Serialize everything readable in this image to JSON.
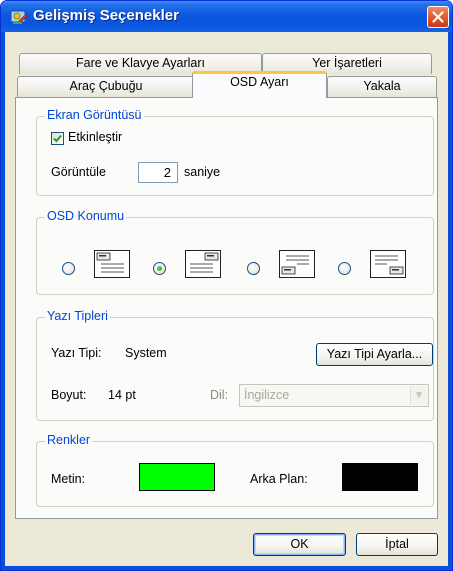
{
  "window": {
    "title": "Gelişmiş Seçenekler",
    "app_icon": "options-app-icon",
    "close_icon": "close-icon"
  },
  "tabs": {
    "back_row": [
      {
        "label": "Fare ve Klavye Ayarları"
      },
      {
        "label": "Yer İşaretleri"
      }
    ],
    "front_row": [
      {
        "label": "Araç Çubuğu"
      },
      {
        "label": "OSD Ayarı",
        "active": true
      },
      {
        "label": "Yakala"
      }
    ]
  },
  "ekran": {
    "title": "Ekran Görüntüsü",
    "enable_label": "Etkinleştir",
    "enable_checked": true,
    "display_label": "Görüntüle",
    "seconds_value": "2",
    "seconds_unit": "saniye"
  },
  "osd_position": {
    "title": "OSD Konumu",
    "options": [
      {
        "name": "top-left",
        "selected": false
      },
      {
        "name": "top-right",
        "selected": true
      },
      {
        "name": "bottom-left",
        "selected": false
      },
      {
        "name": "bottom-right",
        "selected": false
      }
    ]
  },
  "fonts": {
    "title": "Yazı Tipleri",
    "font_label": "Yazı Tipi:",
    "font_value": "System",
    "font_button": "Yazı Tipi Ayarla...",
    "size_label": "Boyut:",
    "size_value": "14 pt",
    "lang_label": "Dil:",
    "lang_value": "İngilizce",
    "lang_disabled": true
  },
  "colors": {
    "title": "Renkler",
    "text_label": "Metin:",
    "text_color": "#00ff00",
    "bg_label": "Arka Plan:",
    "bg_color": "#000000"
  },
  "footer": {
    "ok_label": "OK",
    "cancel_label": "İptal"
  },
  "theme": {
    "accent": "#0046d5",
    "tab_highlight": "#ffc83c",
    "titlebar": "#0a55dd"
  }
}
